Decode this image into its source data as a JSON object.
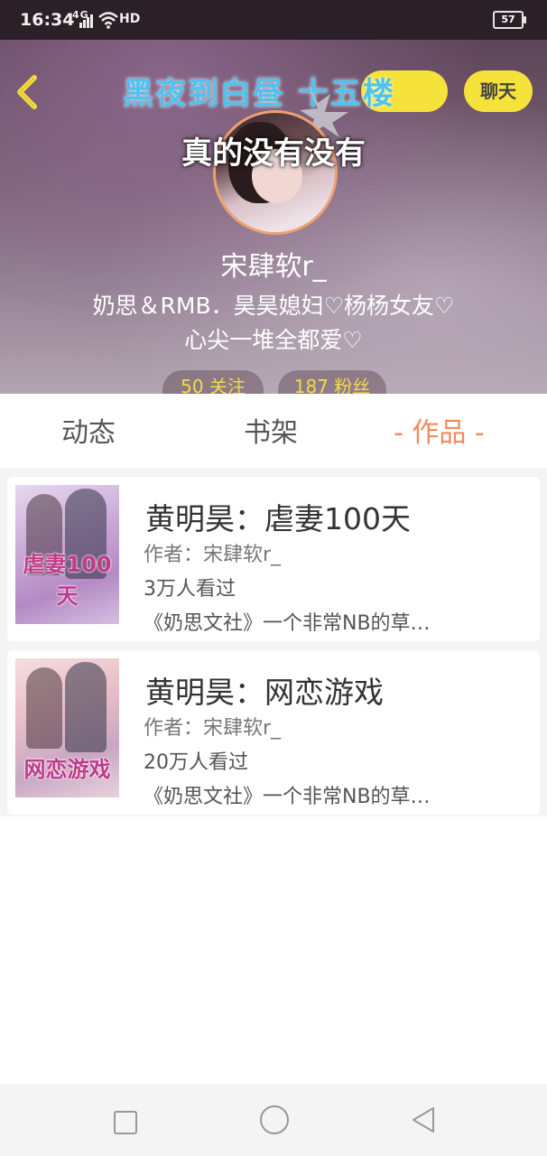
{
  "status_bar": {
    "time": "16:34",
    "signal": "4G",
    "hd": "HD",
    "battery": "57"
  },
  "header": {
    "back_icon": "chevron-left-icon",
    "banner": "黑夜到白昼 十五楼",
    "status_text": "真的没有没有",
    "chat_label": "聊天",
    "username": "宋肆软r_",
    "bio_line1": "奶思＆RMB．昊昊媳妇♡杨杨女友♡",
    "bio_line2": "心尖一堆全都爱♡",
    "following": "50 关注",
    "followers": "187 粉丝"
  },
  "tabs": [
    {
      "label": "动态"
    },
    {
      "label": "书架"
    },
    {
      "label": "- 作品 -"
    }
  ],
  "books": [
    {
      "title": "黄明昊：虐妻100天",
      "cover_text": "虐妻100天",
      "author": "作者：宋肆软r_",
      "views": "3万人看过",
      "desc": "《奶思文社》一个非常NB的草…"
    },
    {
      "title": "黄明昊：网恋游戏",
      "cover_text": "网恋游戏",
      "author": "作者：宋肆软r_",
      "views": "20万人看过",
      "desc": "《奶思文社》一个非常NB的草…"
    }
  ],
  "colors": {
    "accent": "#f08a5d",
    "chat_button": "#f5e23a",
    "banner": "#4fc3f0"
  },
  "nav": {
    "recent_icon": "square-icon",
    "home_icon": "circle-icon",
    "back_icon": "triangle-back-icon"
  }
}
